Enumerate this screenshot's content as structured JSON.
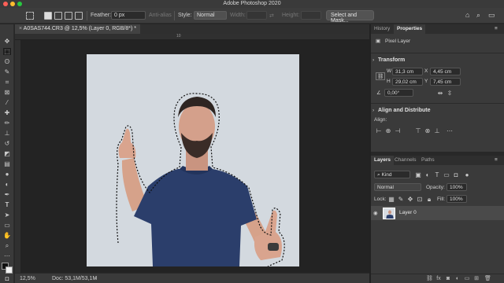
{
  "app": {
    "title": "Adobe Photoshop 2020"
  },
  "options_bar": {
    "feather_label": "Feather:",
    "feather_value": "0 px",
    "antialias_label": "Anti-alias",
    "style_label": "Style:",
    "style_value": "Normal",
    "width_label": "Width:",
    "height_label": "Height:",
    "select_mask_label": "Select and Mask..."
  },
  "document": {
    "tab_title": "A0SAS744.CR3 @ 12,5% (Layer 0, RGB/8*) *",
    "ruler_label": "10"
  },
  "status_bar": {
    "zoom": "12,5%",
    "doc_size": "Doc: 53,1M/53,1M"
  },
  "properties": {
    "tabs": [
      "History",
      "Properties"
    ],
    "layer_kind": "Pixel Layer",
    "transform_title": "Transform",
    "w_label": "W",
    "w_value": "31,3 cm",
    "x_label": "X",
    "x_value": "4,45 cm",
    "h_label": "H",
    "h_value": "29,02 cm",
    "y_label": "Y",
    "y_value": "7,45 cm",
    "angle_value": "0,00°",
    "align_title": "Align and Distribute",
    "align_label": "Align:"
  },
  "layers": {
    "tabs": [
      "Layers",
      "Channels",
      "Paths"
    ],
    "filter_kind": "Kind",
    "blend_mode": "Normal",
    "opacity_label": "Opacity:",
    "opacity_value": "100%",
    "lock_label": "Lock:",
    "fill_label": "Fill:",
    "fill_value": "100%",
    "layer_name": "Layer 0"
  },
  "colors": {
    "accent_red": "#fd5f57",
    "accent_yellow": "#febc2e",
    "accent_green": "#28c840",
    "shirt": "#2b3e6b",
    "backdrop": "#d7dce2"
  }
}
